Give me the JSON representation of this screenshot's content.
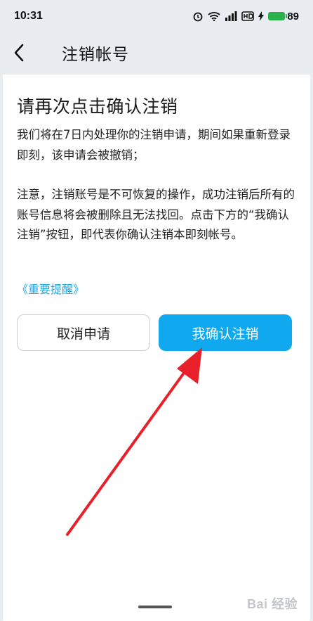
{
  "status_bar": {
    "time": "10:31",
    "battery": "89",
    "icons": [
      "alarm-icon",
      "wifi-icon",
      "signal-icon",
      "hd-icon",
      "charging-icon",
      "battery-icon"
    ]
  },
  "header": {
    "title": "注销帐号",
    "back_icon": "chevron-left-icon"
  },
  "main": {
    "heading": "请再次点击确认注销",
    "paragraph1": "我们将在7日内处理你的注销申请，期间如果重新登录即刻，该申请会被撤销；",
    "paragraph2": "注意，注销账号是不可恢复的操作，成功注销后所有的账号信息将会被删除且无法找回。点击下方的“我确认注销”按钮，即代表你确认注销本即刻帐号。",
    "reminder_link": "《重要提醒》"
  },
  "buttons": {
    "cancel_label": "取消申请",
    "confirm_label": "我确认注销"
  },
  "watermark": {
    "text": "Bai 经验"
  },
  "colors": {
    "accent": "#10a8ee",
    "link": "#1aa7e6",
    "arrow": "#e8202a",
    "battery": "#2bb14c",
    "background": "#e9edf1"
  }
}
